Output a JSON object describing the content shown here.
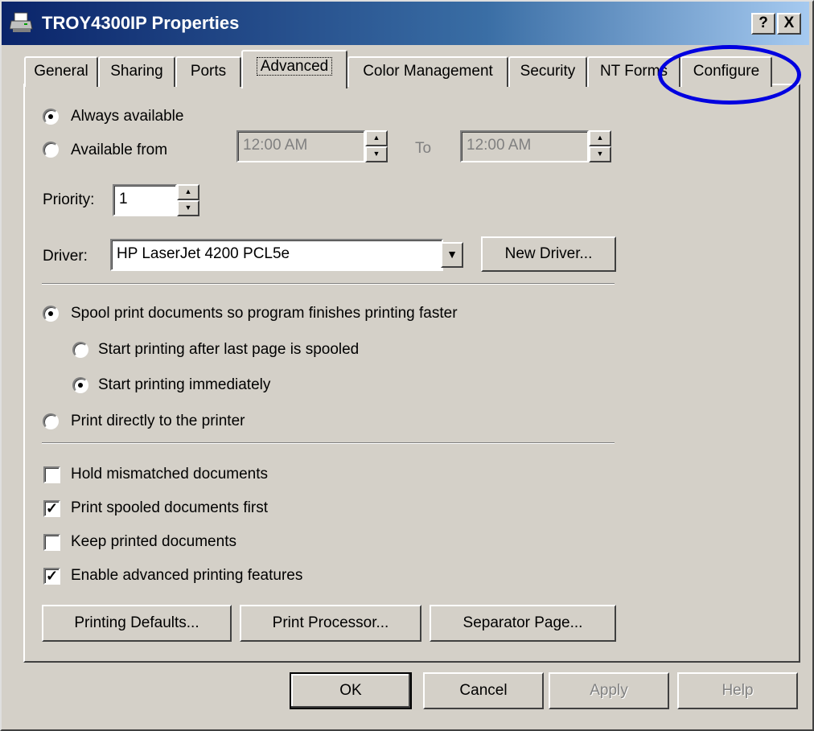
{
  "window": {
    "title": "TROY4300IP Properties",
    "help_button": "?",
    "close_button": "X"
  },
  "tabs": [
    {
      "label": "General"
    },
    {
      "label": "Sharing"
    },
    {
      "label": "Ports"
    },
    {
      "label": "Advanced"
    },
    {
      "label": "Color Management"
    },
    {
      "label": "Security"
    },
    {
      "label": "NT Forms"
    },
    {
      "label": "Configure"
    }
  ],
  "availability": {
    "always_label": "Always available",
    "from_label": "Available from",
    "from_value": "12:00 AM",
    "to_label": "To",
    "to_value": "12:00 AM"
  },
  "priority": {
    "label": "Priority:",
    "value": "1"
  },
  "driver": {
    "label": "Driver:",
    "value": "HP LaserJet 4200 PCL5e",
    "new_button": "New Driver..."
  },
  "spool": {
    "main_label": "Spool print documents so program finishes printing faster",
    "after_last_page_label": "Start printing after last page is spooled",
    "immediately_label": "Start printing immediately",
    "direct_label": "Print directly to the printer"
  },
  "options": {
    "hold_mismatched": "Hold mismatched documents",
    "print_spooled_first": "Print spooled documents first",
    "keep_printed": "Keep printed documents",
    "enable_advanced": "Enable advanced printing features",
    "check_mark": "✓"
  },
  "buttons": {
    "printing_defaults": "Printing Defaults...",
    "print_processor": "Print Processor...",
    "separator_page": "Separator Page...",
    "ok": "OK",
    "cancel": "Cancel",
    "apply": "Apply",
    "help": "Help"
  }
}
